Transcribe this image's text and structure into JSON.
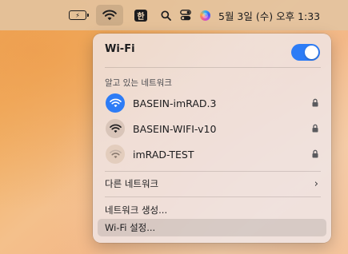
{
  "menubar": {
    "battery_icon": "battery-charging-icon",
    "wifi_icon": "wifi-icon",
    "input_source_label": "한",
    "search_icon": "search-icon",
    "control_center_icon": "control-center-icon",
    "siri_icon": "siri-icon",
    "clock": "5월 3일 (수) 오후 1:33"
  },
  "wifi_menu": {
    "title": "Wi-Fi",
    "toggle_on": true,
    "accent": "#2d7cf6",
    "known_networks_label": "알고 있는 네트워크",
    "networks": [
      {
        "name": "BASEIN-imRAD.3",
        "connected": true,
        "secured": true,
        "icon_color": "#2d7cf6"
      },
      {
        "name": "BASEIN-WIFI-v10",
        "connected": false,
        "secured": true,
        "icon_color": "#d9c5b9"
      },
      {
        "name": "imRAD-TEST",
        "connected": false,
        "secured": true,
        "icon_color": "#e3cdbd"
      }
    ],
    "other_networks_label": "다른 네트워크",
    "create_network_label": "네트워크 생성...",
    "settings_label": "Wi-Fi 설정..."
  }
}
